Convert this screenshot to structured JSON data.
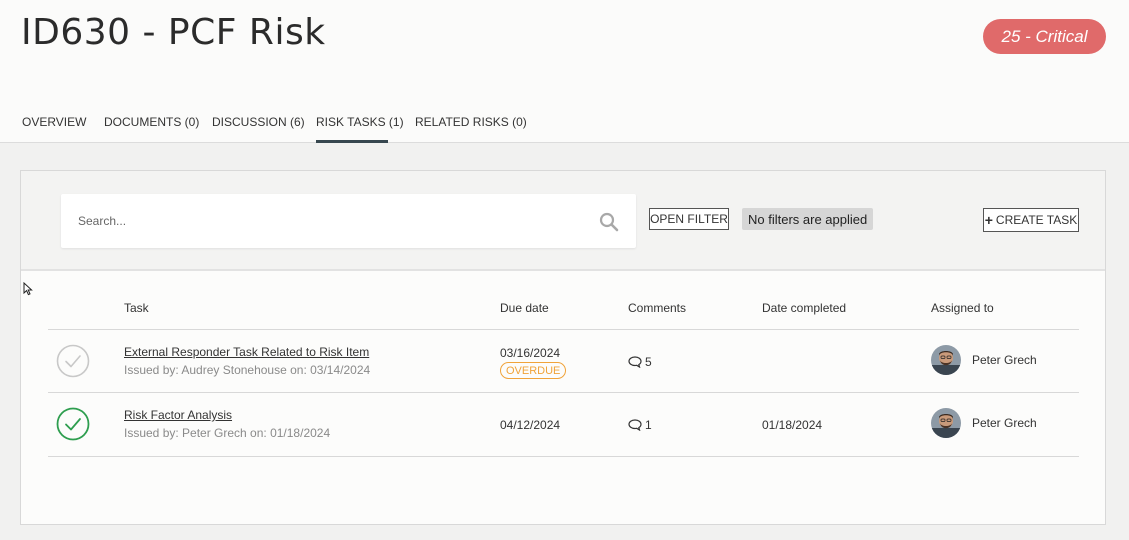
{
  "page": {
    "title": "ID630 - PCF Risk",
    "risk_badge": "25 - Critical"
  },
  "tabs": [
    {
      "label": "OVERVIEW"
    },
    {
      "label": "DOCUMENTS (0)"
    },
    {
      "label": "DISCUSSION (6)"
    },
    {
      "label": "RISK TASKS (1)",
      "active": true
    },
    {
      "label": "RELATED RISKS (0)"
    }
  ],
  "toolbar": {
    "search_placeholder": "Search...",
    "open_filter_label": "OPEN FILTER",
    "filter_status": "No filters are applied",
    "create_task_label": "CREATE TASK"
  },
  "table": {
    "columns": [
      "Task",
      "Due date",
      "Comments",
      "Date completed",
      "Assigned to"
    ],
    "rows": [
      {
        "task": "External Responder Task Related to Risk Item",
        "issued": "Issued by: Audrey Stonehouse on: 03/14/2024",
        "due_date": "03/16/2024",
        "status_badge": "OVERDUE",
        "comments": "5",
        "date_completed": "",
        "assigned_to": "Peter Grech",
        "completed": false
      },
      {
        "task": "Risk Factor Analysis",
        "issued": "Issued by: Peter Grech on: 01/18/2024",
        "due_date": "04/12/2024",
        "status_badge": "",
        "comments": "1",
        "date_completed": "01/18/2024",
        "assigned_to": "Peter Grech",
        "completed": true
      }
    ]
  },
  "colors": {
    "critical": "#e06a6a",
    "overdue": "#f0a33a",
    "complete": "#2e9e4f",
    "incomplete": "#c8c8c8",
    "active_tab": "#37474f"
  },
  "icons": [
    "search-icon",
    "plus-icon",
    "check-circle-icon",
    "comment-icon",
    "avatar",
    "cursor-icon"
  ]
}
